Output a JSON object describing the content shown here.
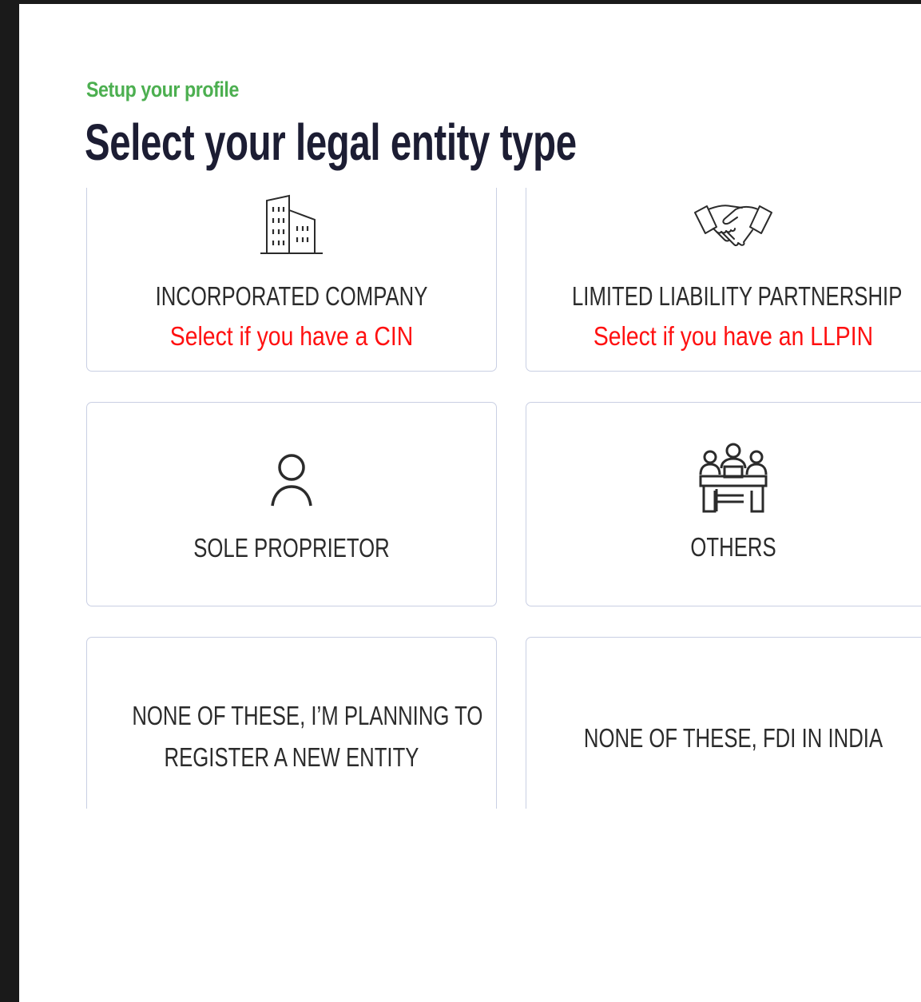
{
  "header": {
    "eyebrow": "Setup your profile",
    "title": "Select your legal entity type"
  },
  "colors": {
    "accent_green": "#4caf50",
    "title_navy": "#1c1d33",
    "hint_red": "#ff1010",
    "card_border": "#c9cfe3"
  },
  "options": [
    {
      "icon": "building-icon",
      "label": "INCORPORATED COMPANY",
      "hint": "Select if you have a CIN"
    },
    {
      "icon": "handshake-icon",
      "label": "LIMITED LIABILITY PARTNERSHIP",
      "hint": "Select if you have an LLPIN"
    },
    {
      "icon": "person-icon",
      "label": "SOLE PROPRIETOR"
    },
    {
      "icon": "group-meeting-icon",
      "label": "OTHERS"
    },
    {
      "label_lines": [
        "NONE OF THESE, I’M PLANNING TO",
        "REGISTER A NEW ENTITY"
      ]
    },
    {
      "label": "NONE OF THESE, FDI IN INDIA"
    }
  ]
}
